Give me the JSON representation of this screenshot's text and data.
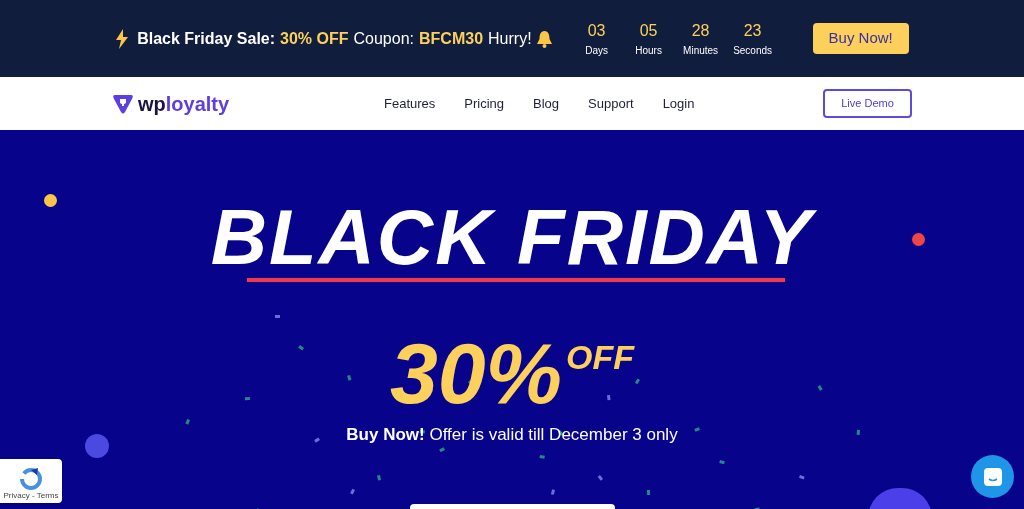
{
  "announcement": {
    "segments": [
      {
        "text": "Black Friday Sale:",
        "kind": "bold"
      },
      {
        "text": "30% OFF",
        "kind": "accent"
      },
      {
        "text": "Coupon:",
        "kind": "plain"
      },
      {
        "text": "BFCM30",
        "kind": "accent"
      },
      {
        "text": "Hurry!",
        "kind": "plain"
      }
    ],
    "countdown": [
      {
        "value": "03",
        "unit": "Days"
      },
      {
        "value": "05",
        "unit": "Hours"
      },
      {
        "value": "28",
        "unit": "Minutes"
      },
      {
        "value": "23",
        "unit": "Seconds"
      }
    ],
    "button": "Buy Now!"
  },
  "nav": {
    "logo": {
      "prefix": "wp",
      "suffix": "loyalty"
    },
    "links": [
      "Features",
      "Pricing",
      "Blog",
      "Support",
      "Login"
    ],
    "button": "Live Demo"
  },
  "hero": {
    "title": "BLACK FRIDAY",
    "discount": "30%",
    "discount_suffix": "OFF",
    "offer": "**Buy Now!** Offer is valid till December 3 only"
  },
  "recaptcha": {
    "links": "Privacy - Terms"
  }
}
